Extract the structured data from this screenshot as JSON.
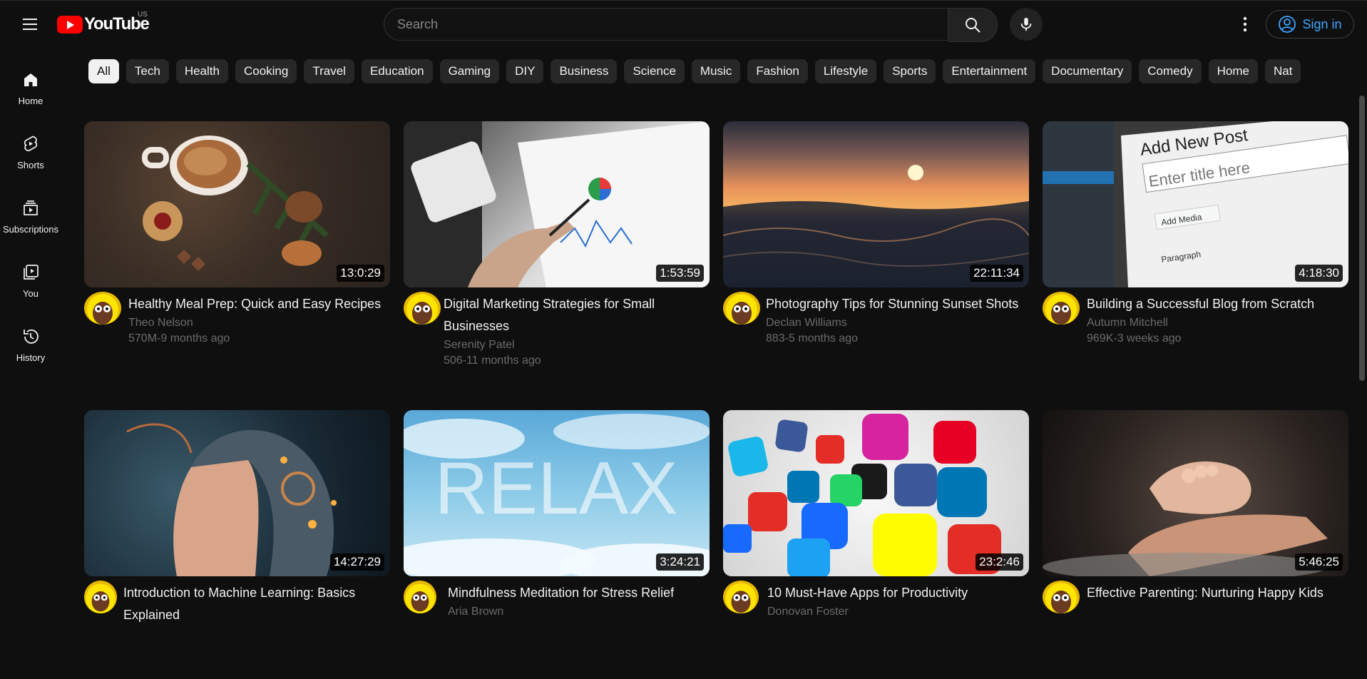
{
  "header": {
    "logo_text": "YouTube",
    "region": "US",
    "search_placeholder": "Search",
    "signin_label": "Sign in",
    "accent": "#3ea6ff",
    "brand_red": "#ff0000"
  },
  "sidebar": {
    "items": [
      {
        "label": "Home",
        "icon": "home-icon"
      },
      {
        "label": "Shorts",
        "icon": "shorts-icon"
      },
      {
        "label": "Subscriptions",
        "icon": "subscriptions-icon"
      },
      {
        "label": "You",
        "icon": "you-icon"
      },
      {
        "label": "History",
        "icon": "history-icon"
      }
    ]
  },
  "chips": [
    "All",
    "Tech",
    "Health",
    "Cooking",
    "Travel",
    "Education",
    "Gaming",
    "DIY",
    "Business",
    "Science",
    "Music",
    "Fashion",
    "Lifestyle",
    "Sports",
    "Entertainment",
    "Documentary",
    "Comedy",
    "Home",
    "Nat"
  ],
  "videos": [
    {
      "title": "Healthy Meal Prep: Quick and Easy Recipes",
      "channel": "Theo Nelson",
      "stats": "570M-9 months ago",
      "duration": "13:0:29"
    },
    {
      "title": "Digital Marketing Strategies for Small Businesses",
      "channel": "Serenity Patel",
      "stats": "506-11 months ago",
      "duration": "1:53:59"
    },
    {
      "title": "Photography Tips for Stunning Sunset Shots",
      "channel": "Declan Williams",
      "stats": "883-5 months ago",
      "duration": "22:11:34"
    },
    {
      "title": "Building a Successful Blog from Scratch",
      "channel": "Autumn Mitchell",
      "stats": "969K-3 weeks ago",
      "duration": "4:18:30"
    },
    {
      "title": "Introduction to Machine Learning: Basics Explained",
      "channel": "",
      "stats": "",
      "duration": "14:27:29"
    },
    {
      "title": "Mindfulness Meditation for Stress Relief",
      "channel": "Aria Brown",
      "stats": "",
      "duration": "3:24:21"
    },
    {
      "title": "10 Must-Have Apps for Productivity",
      "channel": "Donovan Foster",
      "stats": "",
      "duration": "23:2:46"
    },
    {
      "title": "Effective Parenting: Nurturing Happy Kids",
      "channel": "",
      "stats": "",
      "duration": "5:46:25"
    }
  ],
  "thumb_images": {
    "v4_post_title": "Add New Post",
    "v4_placeholder": "Enter title here",
    "v4_add_media": "Add Media",
    "v4_paragraph": "Paragraph",
    "v6_word": "RELAX"
  }
}
